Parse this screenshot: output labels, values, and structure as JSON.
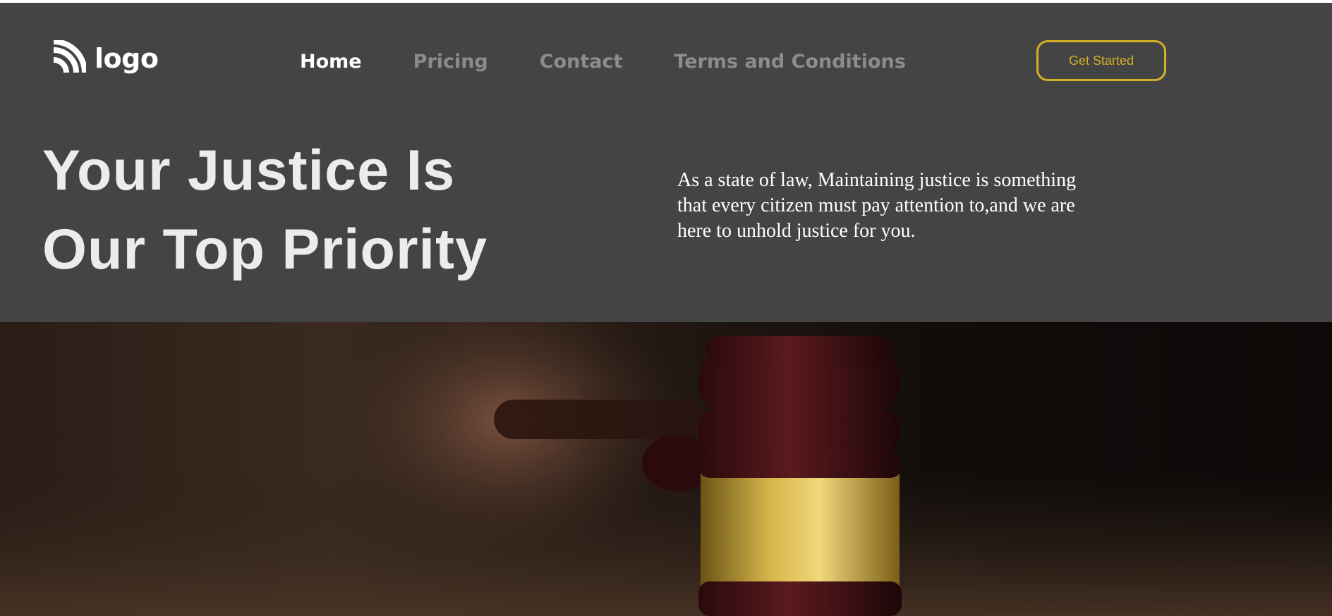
{
  "brand": {
    "logo_text": "logo",
    "logo_icon": "wifi-logo-icon"
  },
  "nav": {
    "items": [
      {
        "label": "Home",
        "active": true
      },
      {
        "label": "Pricing",
        "active": false
      },
      {
        "label": "Contact",
        "active": false
      },
      {
        "label": "Terms and Conditions",
        "active": false
      }
    ]
  },
  "cta": {
    "label": "Get Started"
  },
  "hero": {
    "title_line1": "Your Justice Is",
    "title_line2": "Our Top Priority",
    "description": "As a state of law, Maintaining justice is something that every citizen must pay attention to,and we are here to unhold justice for you."
  },
  "hero_image": {
    "subject": "gavel-photo"
  },
  "colors": {
    "header_bg": "#454444",
    "accent": "#d1b226",
    "nav_active": "#ffffff",
    "nav_inactive": "#8c8c8c",
    "title": "#ececec"
  }
}
